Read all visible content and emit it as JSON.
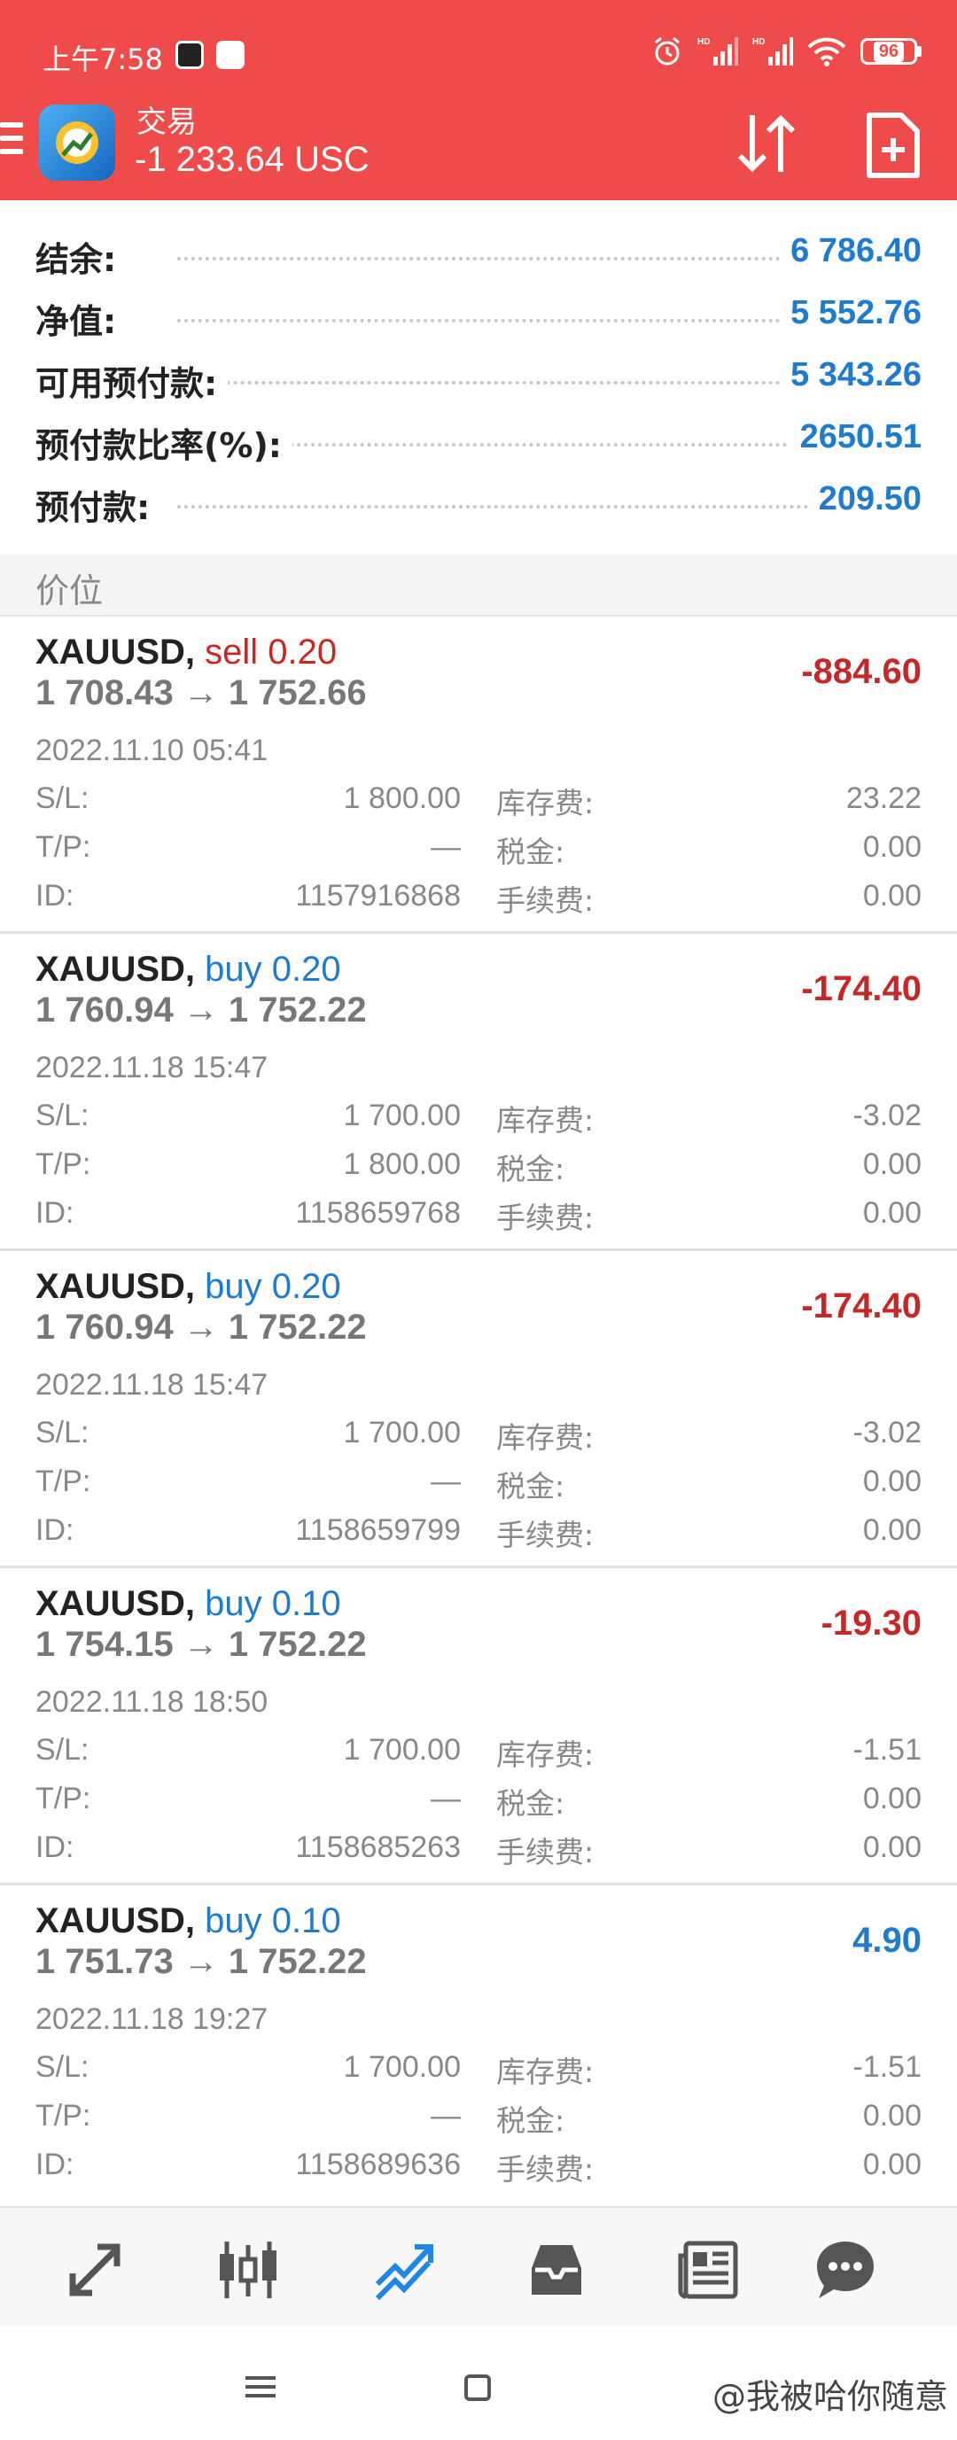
{
  "status_bar": {
    "time": "上午7:58",
    "battery": "96",
    "icons": [
      "app-icon",
      "toutiao-icon",
      "alarm-icon",
      "signal-hd-icon",
      "signal-hd-icon",
      "wifi-icon",
      "battery-icon"
    ]
  },
  "header": {
    "title": "交易",
    "profit": "-1 233.64 USC",
    "background_color": "#f04b4b"
  },
  "summary": {
    "rows": [
      {
        "label": "结余:",
        "value": "6 786.40"
      },
      {
        "label": "净值:",
        "value": "5 552.76"
      },
      {
        "label": "可用预付款:",
        "value": "5 343.26"
      },
      {
        "label": "预付款比率(%):",
        "value": "2650.51"
      },
      {
        "label": "预付款:",
        "value": "209.50"
      }
    ],
    "value_color": "#1e7bcf"
  },
  "section": {
    "title": "价位"
  },
  "positions": [
    {
      "symbol": "XAUUSD,",
      "side": "sell 0.20",
      "prices": "1 708.43 → 1 752.66",
      "profit": "-884.60",
      "time": "2022.11.10 05:41",
      "sl_label": "S/L:",
      "sl": "1 800.00",
      "tp_label": "T/P:",
      "tp": "—",
      "id_label": "ID:",
      "id": "1157916868",
      "swap_label": "库存费:",
      "swap": "23.22",
      "tax_label": "税金:",
      "tax": "0.00",
      "fee_label": "手续费:",
      "fee": "0.00"
    },
    {
      "symbol": "XAUUSD,",
      "side": "buy 0.20",
      "prices": "1 760.94 → 1 752.22",
      "profit": "-174.40",
      "time": "2022.11.18 15:47",
      "sl_label": "S/L:",
      "sl": "1 700.00",
      "tp_label": "T/P:",
      "tp": "1 800.00",
      "id_label": "ID:",
      "id": "1158659768",
      "swap_label": "库存费:",
      "swap": "-3.02",
      "tax_label": "税金:",
      "tax": "0.00",
      "fee_label": "手续费:",
      "fee": "0.00"
    },
    {
      "symbol": "XAUUSD,",
      "side": "buy 0.20",
      "prices": "1 760.94 → 1 752.22",
      "profit": "-174.40",
      "time": "2022.11.18 15:47",
      "sl_label": "S/L:",
      "sl": "1 700.00",
      "tp_label": "T/P:",
      "tp": "—",
      "id_label": "ID:",
      "id": "1158659799",
      "swap_label": "库存费:",
      "swap": "-3.02",
      "tax_label": "税金:",
      "tax": "0.00",
      "fee_label": "手续费:",
      "fee": "0.00"
    },
    {
      "symbol": "XAUUSD,",
      "side": "buy 0.10",
      "prices": "1 754.15 → 1 752.22",
      "profit": "-19.30",
      "time": "2022.11.18 18:50",
      "sl_label": "S/L:",
      "sl": "1 700.00",
      "tp_label": "T/P:",
      "tp": "—",
      "id_label": "ID:",
      "id": "1158685263",
      "swap_label": "库存费:",
      "swap": "-1.51",
      "tax_label": "税金:",
      "tax": "0.00",
      "fee_label": "手续费:",
      "fee": "0.00"
    },
    {
      "symbol": "XAUUSD,",
      "side": "buy 0.10",
      "prices": "1 751.73 → 1 752.22",
      "profit": "4.90",
      "time": "2022.11.18 19:27",
      "sl_label": "S/L:",
      "sl": "1 700.00",
      "tp_label": "T/P:",
      "tp": "—",
      "id_label": "ID:",
      "id": "1158689636",
      "swap_label": "库存费:",
      "swap": "-1.51",
      "tax_label": "税金:",
      "tax": "0.00",
      "fee_label": "手续费:",
      "fee": "0.00"
    }
  ],
  "colors": {
    "sell": "#c62828",
    "buy": "#1e7bcf",
    "loss": "#c62828",
    "gain": "#1e7bcf"
  },
  "tabbar": {
    "tabs": [
      "quotes-icon",
      "chart-icon",
      "trade-icon",
      "history-icon",
      "news-icon",
      "messages-icon"
    ],
    "active": "trade-icon"
  },
  "system_nav": {
    "watermark": "@我被哈你随意"
  }
}
